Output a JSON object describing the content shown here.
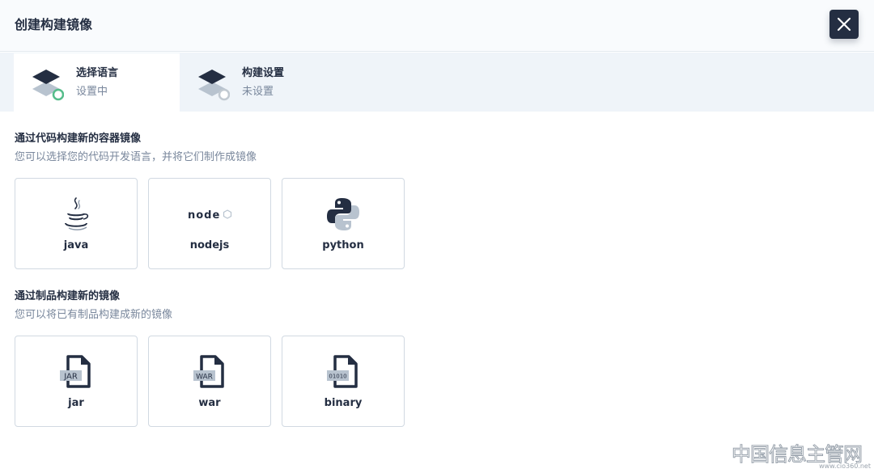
{
  "header": {
    "title": "创建构建镜像",
    "close_icon": "close-icon"
  },
  "steps": [
    {
      "title": "选择语言",
      "status": "设置中",
      "state": "active"
    },
    {
      "title": "构建设置",
      "status": "未设置",
      "state": "pending"
    }
  ],
  "sections": [
    {
      "title": "通过代码构建新的容器镜像",
      "description": "您可以选择您的代码开发语言，并将它们制作成镜像",
      "options": [
        {
          "label": "java",
          "icon": "java-icon"
        },
        {
          "label": "nodejs",
          "icon": "nodejs-icon"
        },
        {
          "label": "python",
          "icon": "python-icon"
        }
      ]
    },
    {
      "title": "通过制品构建新的镜像",
      "description": "您可以将已有制品构建成新的镜像",
      "options": [
        {
          "label": "jar",
          "icon": "jar-file-icon",
          "badge": "JAR"
        },
        {
          "label": "war",
          "icon": "war-file-icon",
          "badge": "WAR"
        },
        {
          "label": "binary",
          "icon": "binary-file-icon",
          "badge": "01010"
        }
      ]
    }
  ],
  "icons": {
    "nodejs_wordmark": "node"
  },
  "watermark": {
    "text": "中国信息主管网",
    "url": "www.cio360.net"
  },
  "colors": {
    "primary": "#242e42",
    "success": "#55bc8a",
    "muted": "#79879c",
    "border": "#d1d9e2",
    "tab_bg": "#eff4f9"
  }
}
